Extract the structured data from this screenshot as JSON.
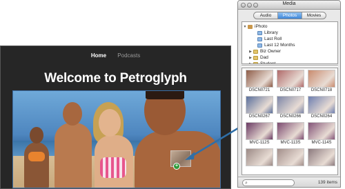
{
  "website": {
    "nav": {
      "home": "Home",
      "podcasts": "Podcasts"
    },
    "title": "Welcome to Petroglyph",
    "drag_badge": "+"
  },
  "media_browser": {
    "window_title": "Media",
    "tabs": [
      {
        "label": "Audio",
        "selected": false
      },
      {
        "label": "Photos",
        "selected": true
      },
      {
        "label": "Movies",
        "selected": false
      }
    ],
    "sources": [
      {
        "label": "iPhoto",
        "disclosure": "▼",
        "icon": "iphoto-icon"
      },
      {
        "label": "Library",
        "disclosure": "",
        "icon": "photo-album-icon"
      },
      {
        "label": "Last Roll",
        "disclosure": "",
        "icon": "photo-album-icon"
      },
      {
        "label": "Last 12 Months",
        "disclosure": "",
        "icon": "photo-album-icon"
      },
      {
        "label": "Biz Owner",
        "disclosure": "▶",
        "icon": "folder-icon"
      },
      {
        "label": "Dad",
        "disclosure": "▶",
        "icon": "folder-icon"
      },
      {
        "label": "Student",
        "disclosure": "▶",
        "icon": "folder-icon"
      }
    ],
    "photos": [
      {
        "caption": "DSCN0721",
        "color": "#8e5c48"
      },
      {
        "caption": "DSCN0717",
        "color": "#b06a6a"
      },
      {
        "caption": "DSCN0718",
        "color": "#c98b6e"
      },
      {
        "caption": "DSCN0267",
        "color": "#5a6f9c"
      },
      {
        "caption": "DSCN0266",
        "color": "#7d86a8"
      },
      {
        "caption": "DSCN0264",
        "color": "#6e7fb0"
      },
      {
        "caption": "MVC-112S",
        "color": "#6a3a63"
      },
      {
        "caption": "MVC-113S",
        "color": "#7c4a70"
      },
      {
        "caption": "MVC-114S",
        "color": "#835478"
      },
      {
        "caption": "",
        "color": "#9c8a86"
      },
      {
        "caption": "",
        "color": "#a38f8b"
      },
      {
        "caption": "",
        "color": "#8c7a7e"
      }
    ],
    "item_count": "139 items",
    "accent_color": "#3f86d8"
  }
}
